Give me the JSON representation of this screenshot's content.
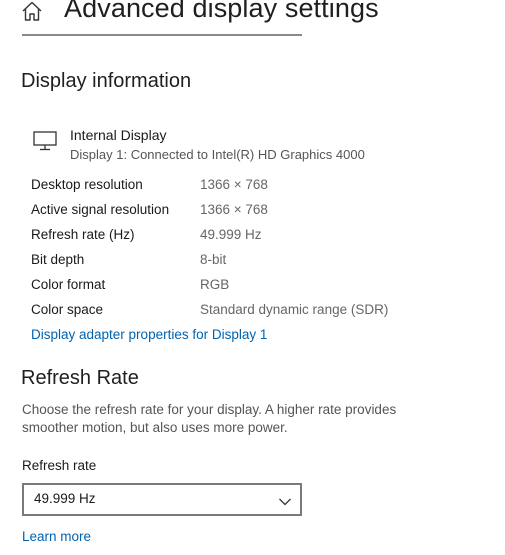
{
  "header": {
    "title": "Advanced display settings",
    "home_icon": "home-icon"
  },
  "display_information": {
    "heading": "Display information",
    "display_icon": "monitor-icon",
    "display_name": "Internal Display",
    "display_subtitle": "Display 1: Connected to Intel(R) HD Graphics 4000",
    "rows": [
      {
        "label": "Desktop resolution",
        "value": "1366 × 768"
      },
      {
        "label": "Active signal resolution",
        "value": "1366 × 768"
      },
      {
        "label": "Refresh rate (Hz)",
        "value": "49.999 Hz"
      },
      {
        "label": "Bit depth",
        "value": "8-bit"
      },
      {
        "label": "Color format",
        "value": "RGB"
      },
      {
        "label": "Color space",
        "value": "Standard dynamic range (SDR)"
      }
    ],
    "adapter_link": "Display adapter properties for Display 1"
  },
  "refresh_rate": {
    "heading": "Refresh Rate",
    "description": "Choose the refresh rate for your display. A higher rate provides smoother motion, but also uses more power.",
    "field_label": "Refresh rate",
    "selected_value": "49.999 Hz",
    "learn_more": "Learn more"
  },
  "colors": {
    "link": "#0063b1",
    "text": "#1a1a1a",
    "secondary_text": "#666666",
    "border": "#7a7a7a"
  }
}
